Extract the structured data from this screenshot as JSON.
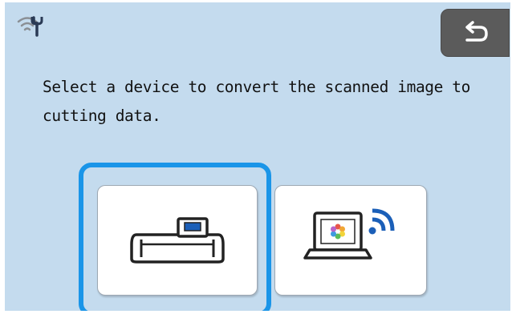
{
  "message": "Select a device to convert the scanned image to cutting data.",
  "icons": {
    "status": "wifi-wrench-icon",
    "back": "back-arrow-icon",
    "cutter": "cutting-machine-icon",
    "computer": "laptop-wireless-icon"
  },
  "devices": [
    {
      "name": "cutting-machine",
      "selected": true
    },
    {
      "name": "computer-wireless",
      "selected": false
    }
  ],
  "colors": {
    "background": "#c4dbee",
    "selection": "#1a95e8",
    "back_button": "#5b5b5b"
  }
}
